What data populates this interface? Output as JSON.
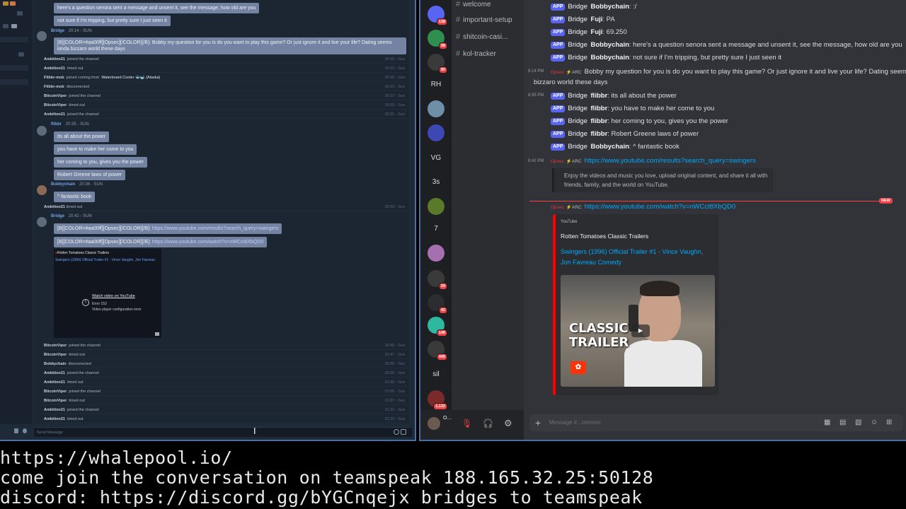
{
  "left_panel": {
    "messages_top": [
      "here's a question senora sent a message and unsent it, see the message, how old are you",
      "not sure if I'm tripping, but pretty sure I just seen it"
    ],
    "bridge_header": {
      "name": "Bridge",
      "time": "20:14 - SUN"
    },
    "bridge_message": "[B][COLOR=#aa00ff][Opsec][/COLOR][/B]: Bobby my question for you is do you want to play this game? Or just ignore it and live your life? Dating seems kinda bizzaro world these days",
    "sys_rows_1": [
      {
        "user": "Ambition21",
        "action": "joined the channel",
        "time": "20:15 - Sun"
      },
      {
        "user": "Ambition21",
        "action": "timed out",
        "time": "20:15 - Sun"
      },
      {
        "user": "Flibbr-mob",
        "action": "joined coming from",
        "extra": "Waterboard Cooler 🐳🐋 (Alaska)",
        "time": "20:20 - Sun"
      },
      {
        "user": "Flibbr-mob",
        "action": "disconnected",
        "time": "20:23 - Sun"
      },
      {
        "user": "BitcoinViper",
        "action": "joined the channel",
        "time": "20:27 - Sun"
      },
      {
        "user": "BitcoinViper",
        "action": "timed out",
        "time": "20:29 - Sun"
      },
      {
        "user": "Ambition21",
        "action": "joined the channel",
        "time": "20:31 - Sun"
      }
    ],
    "flibbr_header": {
      "name": "flibbr",
      "time": "20:35 - SUN"
    },
    "flibbr_messages": [
      "its all about the power",
      "you have to make her come to you",
      "her coming to you, gives you the power",
      "Robert Greene laws of power"
    ],
    "bobby_header": {
      "name": "Bobbychain",
      "time": "20:36 - SUN"
    },
    "bobby_message": "^ fantastic book",
    "sys_mid": {
      "user": "Ambition21",
      "action": "timed out",
      "time": "20:59 - Sun"
    },
    "bridge2_header": {
      "name": "Bridge",
      "time": "20:42 - SUN"
    },
    "bridge2_links": [
      {
        "prefix": "[B][COLOR=#aa00ff][Opsec][/COLOR][/B]:",
        "url": "https://www.youtube.com/results?search_query=swingers"
      },
      {
        "prefix": "[B][COLOR=#aa00ff][Opsec][/COLOR][/B]:",
        "url": "https://www.youtube.com/watch?v=nWCct8XbQD0"
      }
    ],
    "embed": {
      "provider": "Rotten Tomatoes Classic Trailers",
      "title": "Swingers (1996) Official Trailer #1 - Vince Vaughn, Jon Favreau",
      "watch": "Watch video on YouTube",
      "error_lines": [
        "Error 153",
        "Video player configuration error"
      ]
    },
    "sys_rows_2": [
      {
        "user": "BitcoinViper",
        "action": "joined the channel",
        "time": "20:45 - Sun"
      },
      {
        "user": "BitcoinViper",
        "action": "timed out",
        "time": "20:47 - Sun"
      },
      {
        "user": "Bobbychain",
        "action": "disconnected",
        "time": "20:50 - Sun"
      },
      {
        "user": "Ambition21",
        "action": "joined the channel",
        "time": "20:55 - Sun"
      },
      {
        "user": "Ambition21",
        "action": "timed out",
        "time": "21:00 - Sun"
      },
      {
        "user": "BitcoinViper",
        "action": "joined the channel",
        "time": "21:05 - Sun"
      },
      {
        "user": "BitcoinViper",
        "action": "timed out",
        "time": "21:07 - Sun"
      },
      {
        "user": "Ambition21",
        "action": "joined the channel",
        "time": "21:10 - Sun"
      },
      {
        "user": "Ambition21",
        "action": "timed out",
        "time": "21:19 - Sun"
      }
    ],
    "input_placeholder": "Send Message"
  },
  "right_panel": {
    "servers": [
      {
        "label": "",
        "badge": "138"
      },
      {
        "label": "",
        "badge": "98"
      },
      {
        "label": "",
        "badge": "90"
      },
      {
        "label": "RH",
        "badge": ""
      },
      {
        "label": "",
        "badge": ""
      },
      {
        "label": "",
        "badge": ""
      },
      {
        "label": "VG",
        "badge": ""
      },
      {
        "label": "3s",
        "badge": ""
      },
      {
        "label": "",
        "badge": ""
      },
      {
        "label": "7",
        "badge": ""
      },
      {
        "label": "",
        "badge": ""
      },
      {
        "label": "",
        "badge": "29"
      },
      {
        "label": "",
        "badge": "42"
      },
      {
        "label": "",
        "badge": "148"
      },
      {
        "label": "",
        "badge": "446"
      },
      {
        "label": "sil",
        "badge": ""
      },
      {
        "label": "",
        "badge": "1,132"
      }
    ],
    "channels": [
      "welcome",
      "important-setup",
      "shitcoin-casi...",
      "kol-tracker"
    ],
    "app_tag": "APP",
    "bridge": "Bridge",
    "messages": [
      {
        "sender": "Bobbychain",
        "text": ": :/"
      },
      {
        "sender": "Fuji",
        "text": ": PA"
      },
      {
        "sender": "Fuji",
        "text": ": 69.250"
      },
      {
        "sender": "Bobbychain",
        "text": ": here's a question senora sent a message and unsent it, see the message, how old are you"
      },
      {
        "sender": "Bobbychain",
        "text": ": not sure if I'm tripping, but pretty sure I just seen it"
      }
    ],
    "opsec_msg": {
      "time": "8:14 PM",
      "name": "Opsec",
      "tag": "ARC",
      "line1": "Bobby my question for you is do you want to play this game? Or just ignore it and live your life? Dating seems kinda",
      "line2": "bizzaro world these days"
    },
    "messages2_time": "8:35 PM",
    "messages2": [
      {
        "sender": "flibbr",
        "text": ": its all about the power"
      },
      {
        "sender": "flibbr",
        "text": ": you have to make her come to you"
      },
      {
        "sender": "flibbr",
        "text": ": her coming to you, gives you the power"
      },
      {
        "sender": "flibbr",
        "text": ": Robert Greene laws of power"
      },
      {
        "sender": "Bobbychain",
        "text": ": ^ fantastic book"
      }
    ],
    "link1": {
      "time": "8:42 PM",
      "name": "Opsec",
      "tag": "ARC",
      "url": "https://www.youtube.com/results?search_query=swingers"
    },
    "yt_desc": "Enjoy the videos and music you love, upload original content, and share it all with friends, family, and the world on YouTube.",
    "new_badge": "NEW",
    "link2": {
      "name": "Opsec",
      "tag": "ARC",
      "url": "https://www.youtube.com/watch?v=nWCct8XbQD0"
    },
    "embed": {
      "provider": "YouTube",
      "author": "Rotten Tomatoes Classic Trailers",
      "title": "Swingers (1996) Official Trailer #1 - Vince Vaughn, Jon Favreau Comedy",
      "thumb_text": "CLASSIC TRAILER"
    },
    "composer_placeholder": "Message #...ommon",
    "user_initial": "O..."
  },
  "terminal": {
    "lines": [
      "https://whalepool.io/",
      "come join the conversation on teamspeak 188.165.32.25:50128",
      "discord: https://discord.gg/bYGCnqejx bridges to teamspeak"
    ]
  }
}
